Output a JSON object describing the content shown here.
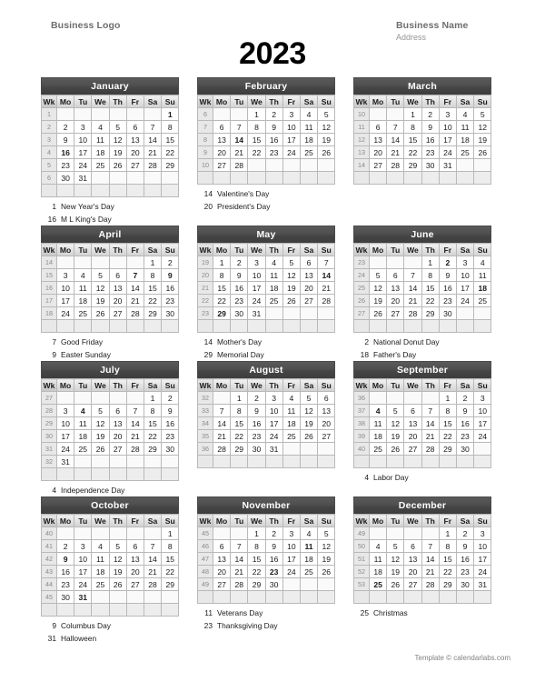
{
  "header": {
    "business_logo": "Business Logo",
    "business_name": "Business Name",
    "address": "Address"
  },
  "year": "2023",
  "weekday_headers": [
    "Wk",
    "Mo",
    "Tu",
    "We",
    "Th",
    "Fr",
    "Sa",
    "Su"
  ],
  "footer": "Template © calendarlabs.com",
  "months": [
    {
      "name": "January",
      "weeks": [
        {
          "wk": "1",
          "days": [
            "",
            "",
            "",
            "",
            "",
            "",
            "1"
          ],
          "bold": [
            6
          ]
        },
        {
          "wk": "2",
          "days": [
            "2",
            "3",
            "4",
            "5",
            "6",
            "7",
            "8"
          ],
          "bold": []
        },
        {
          "wk": "3",
          "days": [
            "9",
            "10",
            "11",
            "12",
            "13",
            "14",
            "15"
          ],
          "bold": []
        },
        {
          "wk": "4",
          "days": [
            "16",
            "17",
            "18",
            "19",
            "20",
            "21",
            "22"
          ],
          "bold": [
            0
          ]
        },
        {
          "wk": "5",
          "days": [
            "23",
            "24",
            "25",
            "26",
            "27",
            "28",
            "29"
          ],
          "bold": []
        },
        {
          "wk": "6",
          "days": [
            "30",
            "31",
            "",
            "",
            "",
            "",
            ""
          ],
          "bold": []
        }
      ],
      "holidays": [
        {
          "day": "1",
          "name": "New Year's Day"
        },
        {
          "day": "16",
          "name": "M L King's Day"
        }
      ]
    },
    {
      "name": "February",
      "weeks": [
        {
          "wk": "6",
          "days": [
            "",
            "",
            "1",
            "2",
            "3",
            "4",
            "5"
          ],
          "bold": []
        },
        {
          "wk": "7",
          "days": [
            "6",
            "7",
            "8",
            "9",
            "10",
            "11",
            "12"
          ],
          "bold": []
        },
        {
          "wk": "8",
          "days": [
            "13",
            "14",
            "15",
            "16",
            "17",
            "18",
            "19"
          ],
          "bold": [
            1
          ]
        },
        {
          "wk": "9",
          "days": [
            "20",
            "21",
            "22",
            "23",
            "24",
            "25",
            "26"
          ],
          "bold": []
        },
        {
          "wk": "10",
          "days": [
            "27",
            "28",
            "",
            "",
            "",
            "",
            ""
          ],
          "bold": []
        },
        {
          "wk": "",
          "days": [
            "",
            "",
            "",
            "",
            "",
            "",
            ""
          ],
          "bold": []
        }
      ],
      "holidays": [
        {
          "day": "14",
          "name": "Valentine's Day"
        },
        {
          "day": "20",
          "name": "President's Day"
        }
      ]
    },
    {
      "name": "March",
      "weeks": [
        {
          "wk": "10",
          "days": [
            "",
            "",
            "1",
            "2",
            "3",
            "4",
            "5"
          ],
          "bold": []
        },
        {
          "wk": "11",
          "days": [
            "6",
            "7",
            "8",
            "9",
            "10",
            "11",
            "12"
          ],
          "bold": []
        },
        {
          "wk": "12",
          "days": [
            "13",
            "14",
            "15",
            "16",
            "17",
            "18",
            "19"
          ],
          "bold": []
        },
        {
          "wk": "13",
          "days": [
            "20",
            "21",
            "22",
            "23",
            "24",
            "25",
            "26"
          ],
          "bold": []
        },
        {
          "wk": "14",
          "days": [
            "27",
            "28",
            "29",
            "30",
            "31",
            "",
            ""
          ],
          "bold": []
        },
        {
          "wk": "",
          "days": [
            "",
            "",
            "",
            "",
            "",
            "",
            ""
          ],
          "bold": []
        }
      ],
      "holidays": []
    },
    {
      "name": "April",
      "weeks": [
        {
          "wk": "14",
          "days": [
            "",
            "",
            "",
            "",
            "",
            "1",
            "2"
          ],
          "bold": []
        },
        {
          "wk": "15",
          "days": [
            "3",
            "4",
            "5",
            "6",
            "7",
            "8",
            "9"
          ],
          "bold": [
            4,
            6
          ]
        },
        {
          "wk": "16",
          "days": [
            "10",
            "11",
            "12",
            "13",
            "14",
            "15",
            "16"
          ],
          "bold": []
        },
        {
          "wk": "17",
          "days": [
            "17",
            "18",
            "19",
            "20",
            "21",
            "22",
            "23"
          ],
          "bold": []
        },
        {
          "wk": "18",
          "days": [
            "24",
            "25",
            "26",
            "27",
            "28",
            "29",
            "30"
          ],
          "bold": []
        },
        {
          "wk": "",
          "days": [
            "",
            "",
            "",
            "",
            "",
            "",
            ""
          ],
          "bold": []
        }
      ],
      "holidays": [
        {
          "day": "7",
          "name": "Good Friday"
        },
        {
          "day": "9",
          "name": "Easter Sunday"
        }
      ]
    },
    {
      "name": "May",
      "weeks": [
        {
          "wk": "19",
          "days": [
            "1",
            "2",
            "3",
            "4",
            "5",
            "6",
            "7"
          ],
          "bold": []
        },
        {
          "wk": "20",
          "days": [
            "8",
            "9",
            "10",
            "11",
            "12",
            "13",
            "14"
          ],
          "bold": [
            6
          ]
        },
        {
          "wk": "21",
          "days": [
            "15",
            "16",
            "17",
            "18",
            "19",
            "20",
            "21"
          ],
          "bold": []
        },
        {
          "wk": "22",
          "days": [
            "22",
            "23",
            "24",
            "25",
            "26",
            "27",
            "28"
          ],
          "bold": []
        },
        {
          "wk": "23",
          "days": [
            "29",
            "30",
            "31",
            "",
            "",
            "",
            ""
          ],
          "bold": [
            0
          ]
        },
        {
          "wk": "",
          "days": [
            "",
            "",
            "",
            "",
            "",
            "",
            ""
          ],
          "bold": []
        }
      ],
      "holidays": [
        {
          "day": "14",
          "name": "Mother's Day"
        },
        {
          "day": "29",
          "name": "Memorial Day"
        }
      ]
    },
    {
      "name": "June",
      "weeks": [
        {
          "wk": "23",
          "days": [
            "",
            "",
            "",
            "1",
            "2",
            "3",
            "4"
          ],
          "bold": [
            4
          ]
        },
        {
          "wk": "24",
          "days": [
            "5",
            "6",
            "7",
            "8",
            "9",
            "10",
            "11"
          ],
          "bold": []
        },
        {
          "wk": "25",
          "days": [
            "12",
            "13",
            "14",
            "15",
            "16",
            "17",
            "18"
          ],
          "bold": [
            6
          ]
        },
        {
          "wk": "26",
          "days": [
            "19",
            "20",
            "21",
            "22",
            "23",
            "24",
            "25"
          ],
          "bold": []
        },
        {
          "wk": "27",
          "days": [
            "26",
            "27",
            "28",
            "29",
            "30",
            "",
            ""
          ],
          "bold": []
        },
        {
          "wk": "",
          "days": [
            "",
            "",
            "",
            "",
            "",
            "",
            ""
          ],
          "bold": []
        }
      ],
      "holidays": [
        {
          "day": "2",
          "name": "National Donut Day"
        },
        {
          "day": "18",
          "name": "Father's Day"
        }
      ]
    },
    {
      "name": "July",
      "weeks": [
        {
          "wk": "27",
          "days": [
            "",
            "",
            "",
            "",
            "",
            "1",
            "2"
          ],
          "bold": []
        },
        {
          "wk": "28",
          "days": [
            "3",
            "4",
            "5",
            "6",
            "7",
            "8",
            "9"
          ],
          "bold": [
            1
          ]
        },
        {
          "wk": "29",
          "days": [
            "10",
            "11",
            "12",
            "13",
            "14",
            "15",
            "16"
          ],
          "bold": []
        },
        {
          "wk": "30",
          "days": [
            "17",
            "18",
            "19",
            "20",
            "21",
            "22",
            "23"
          ],
          "bold": []
        },
        {
          "wk": "31",
          "days": [
            "24",
            "25",
            "26",
            "27",
            "28",
            "29",
            "30"
          ],
          "bold": []
        },
        {
          "wk": "32",
          "days": [
            "31",
            "",
            "",
            "",
            "",
            "",
            ""
          ],
          "bold": []
        }
      ],
      "holidays": [
        {
          "day": "4",
          "name": "Independence Day"
        }
      ]
    },
    {
      "name": "August",
      "weeks": [
        {
          "wk": "32",
          "days": [
            "",
            "1",
            "2",
            "3",
            "4",
            "5",
            "6"
          ],
          "bold": []
        },
        {
          "wk": "33",
          "days": [
            "7",
            "8",
            "9",
            "10",
            "11",
            "12",
            "13"
          ],
          "bold": []
        },
        {
          "wk": "34",
          "days": [
            "14",
            "15",
            "16",
            "17",
            "18",
            "19",
            "20"
          ],
          "bold": []
        },
        {
          "wk": "35",
          "days": [
            "21",
            "22",
            "23",
            "24",
            "25",
            "26",
            "27"
          ],
          "bold": []
        },
        {
          "wk": "36",
          "days": [
            "28",
            "29",
            "30",
            "31",
            "",
            "",
            ""
          ],
          "bold": []
        },
        {
          "wk": "",
          "days": [
            "",
            "",
            "",
            "",
            "",
            "",
            ""
          ],
          "bold": []
        }
      ],
      "holidays": []
    },
    {
      "name": "September",
      "weeks": [
        {
          "wk": "36",
          "days": [
            "",
            "",
            "",
            "",
            "1",
            "2",
            "3"
          ],
          "bold": []
        },
        {
          "wk": "37",
          "days": [
            "4",
            "5",
            "6",
            "7",
            "8",
            "9",
            "10"
          ],
          "bold": [
            0
          ]
        },
        {
          "wk": "38",
          "days": [
            "11",
            "12",
            "13",
            "14",
            "15",
            "16",
            "17"
          ],
          "bold": []
        },
        {
          "wk": "39",
          "days": [
            "18",
            "19",
            "20",
            "21",
            "22",
            "23",
            "24"
          ],
          "bold": []
        },
        {
          "wk": "40",
          "days": [
            "25",
            "26",
            "27",
            "28",
            "29",
            "30",
            ""
          ],
          "bold": []
        },
        {
          "wk": "",
          "days": [
            "",
            "",
            "",
            "",
            "",
            "",
            ""
          ],
          "bold": []
        }
      ],
      "holidays": [
        {
          "day": "4",
          "name": "Labor Day"
        }
      ]
    },
    {
      "name": "October",
      "weeks": [
        {
          "wk": "40",
          "days": [
            "",
            "",
            "",
            "",
            "",
            "",
            "1"
          ],
          "bold": []
        },
        {
          "wk": "41",
          "days": [
            "2",
            "3",
            "4",
            "5",
            "6",
            "7",
            "8"
          ],
          "bold": []
        },
        {
          "wk": "42",
          "days": [
            "9",
            "10",
            "11",
            "12",
            "13",
            "14",
            "15"
          ],
          "bold": [
            0
          ]
        },
        {
          "wk": "43",
          "days": [
            "16",
            "17",
            "18",
            "19",
            "20",
            "21",
            "22"
          ],
          "bold": []
        },
        {
          "wk": "44",
          "days": [
            "23",
            "24",
            "25",
            "26",
            "27",
            "28",
            "29"
          ],
          "bold": []
        },
        {
          "wk": "45",
          "days": [
            "30",
            "31",
            "",
            "",
            "",
            "",
            ""
          ],
          "bold": [
            1
          ]
        }
      ],
      "holidays": [
        {
          "day": "9",
          "name": "Columbus Day"
        },
        {
          "day": "31",
          "name": "Halloween"
        }
      ]
    },
    {
      "name": "November",
      "weeks": [
        {
          "wk": "45",
          "days": [
            "",
            "",
            "1",
            "2",
            "3",
            "4",
            "5"
          ],
          "bold": []
        },
        {
          "wk": "46",
          "days": [
            "6",
            "7",
            "8",
            "9",
            "10",
            "11",
            "12"
          ],
          "bold": [
            5
          ]
        },
        {
          "wk": "47",
          "days": [
            "13",
            "14",
            "15",
            "16",
            "17",
            "18",
            "19"
          ],
          "bold": []
        },
        {
          "wk": "48",
          "days": [
            "20",
            "21",
            "22",
            "23",
            "24",
            "25",
            "26"
          ],
          "bold": [
            3
          ]
        },
        {
          "wk": "49",
          "days": [
            "27",
            "28",
            "29",
            "30",
            "",
            "",
            ""
          ],
          "bold": []
        },
        {
          "wk": "",
          "days": [
            "",
            "",
            "",
            "",
            "",
            "",
            ""
          ],
          "bold": []
        }
      ],
      "holidays": [
        {
          "day": "11",
          "name": "Veterans Day"
        },
        {
          "day": "23",
          "name": "Thanksgiving Day"
        }
      ]
    },
    {
      "name": "December",
      "weeks": [
        {
          "wk": "49",
          "days": [
            "",
            "",
            "",
            "",
            "1",
            "2",
            "3"
          ],
          "bold": []
        },
        {
          "wk": "50",
          "days": [
            "4",
            "5",
            "6",
            "7",
            "8",
            "9",
            "10"
          ],
          "bold": []
        },
        {
          "wk": "51",
          "days": [
            "11",
            "12",
            "13",
            "14",
            "15",
            "16",
            "17"
          ],
          "bold": []
        },
        {
          "wk": "52",
          "days": [
            "18",
            "19",
            "20",
            "21",
            "22",
            "23",
            "24"
          ],
          "bold": []
        },
        {
          "wk": "53",
          "days": [
            "25",
            "26",
            "27",
            "28",
            "29",
            "30",
            "31"
          ],
          "bold": [
            0
          ]
        },
        {
          "wk": "",
          "days": [
            "",
            "",
            "",
            "",
            "",
            "",
            ""
          ],
          "bold": []
        }
      ],
      "holidays": [
        {
          "day": "25",
          "name": "Christmas"
        }
      ]
    }
  ]
}
